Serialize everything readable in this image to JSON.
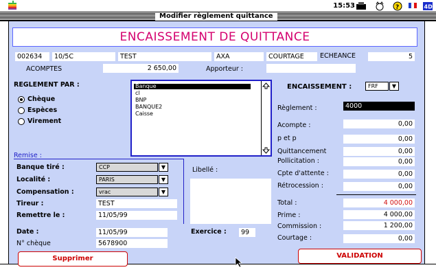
{
  "menubar": {
    "clock": "15:53"
  },
  "window": {
    "title": "Modifier règlement quittance"
  },
  "header": {
    "title": "ENCAISSEMENT DE QUITTANCE"
  },
  "row1": {
    "code": "002634",
    "ref": "10/5C",
    "name": "TEST",
    "company": "AXA",
    "type": "COURTAGE",
    "echeance_label": "ECHEANCE",
    "echeance": "5"
  },
  "row2": {
    "acomptes_label": "ACOMPTES",
    "acomptes": "2 650,00",
    "apporteur_label": "Apporteur :",
    "apporteur": ""
  },
  "reglement": {
    "label": "REGLEMENT PAR :",
    "options": [
      "Chèque",
      "Espèces",
      "Virement"
    ],
    "list": [
      "Banque",
      "cl",
      "BNP",
      "BANQUE2",
      "Caisse"
    ]
  },
  "remise": {
    "label": "Remise :",
    "banque_label": "Banque tiré :",
    "banque": "CCP",
    "localite_label": "Localité :",
    "localite": "PARIS",
    "compensation_label": "Compensation :",
    "compensation": "vrac",
    "tireur_label": "Tireur :",
    "tireur": "TEST",
    "remettre_label": "Remettre le :",
    "remettre": "11/05/99",
    "libelle_label": "Libellé :"
  },
  "bottom": {
    "date_label": "Date :",
    "date": "11/05/99",
    "cheque_label": "N° chèque",
    "cheque": "5678900",
    "exercice_label": "Exercice :",
    "exercice": "99"
  },
  "encaissement": {
    "label": "ENCAISSEMENT :",
    "currency": "FRF",
    "reglement_label": "Règlement :",
    "reglement": "4000",
    "acompte_label": "Acompte :",
    "acompte": "0,00",
    "petp_label": "p et p",
    "petp": "0,00",
    "quittancement_label": "Quittancement",
    "quittancement": "0,00",
    "pollicitation_label": "Pollicitation :",
    "pollicitation": "0,00",
    "attente_label": "Cpte d'attente :",
    "attente": "0,00",
    "retrocession_label": "Rétrocession :",
    "retrocession": "0,00",
    "total_label": "Total :",
    "total": "4 000,00",
    "prime_label": "Prime :",
    "prime": "4 000,00",
    "commission_label": "Commission :",
    "commission": "1 200,00",
    "courtage_label": "Courtage :",
    "courtage": "0,00"
  },
  "buttons": {
    "supprimer": "Supprimer",
    "validation": "VALIDATION"
  }
}
